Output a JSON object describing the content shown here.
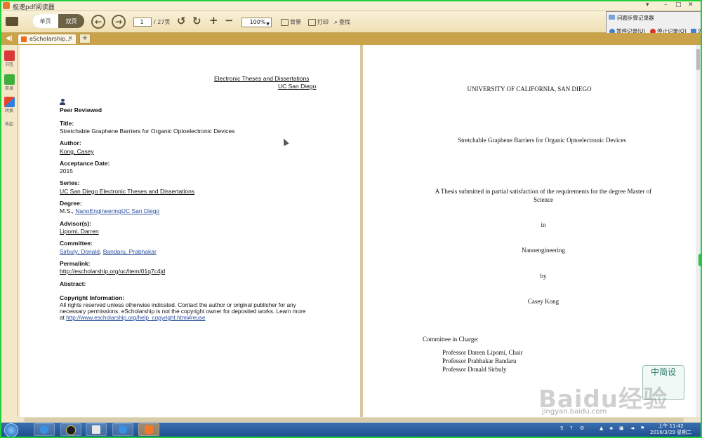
{
  "window": {
    "title": "极速pdf阅读器"
  },
  "toolbar": {
    "single_page": "单页",
    "double_page": "双页",
    "page_current": "1",
    "page_total": "/ 27页",
    "zoom": "100%",
    "background": "背景",
    "print": "打印",
    "find": "查找"
  },
  "popup": {
    "title": "问题步骤记录器",
    "pause": "暂停记录(U)",
    "stop": "停止记录(O)",
    "add": "添"
  },
  "tabs": [
    {
      "label": "eScholarship..."
    }
  ],
  "sidebar": {
    "items": [
      {
        "label": "书签"
      },
      {
        "label": "目录"
      },
      {
        "label": "转换"
      },
      {
        "label": "收起"
      }
    ]
  },
  "left_page": {
    "header_line1": "Electronic Theses and Dissertations",
    "header_line2": "UC San Diego",
    "peer_reviewed": "Peer Reviewed",
    "title_label": "Title:",
    "title_value": "Stretchable Graphene Barriers for Organic Optoelectronic Devices",
    "author_label": "Author:",
    "author_value": "Kong, Casey",
    "acceptance_label": "Acceptance Date:",
    "acceptance_value": "2015",
    "series_label": "Series:",
    "series_value": "UC San Diego Electronic Theses and Dissertations",
    "degree_label": "Degree:",
    "degree_prefix": "M.S., ",
    "degree_value": "NanoEngineeringUC San Diego",
    "advisor_label": "Advisor(s):",
    "advisor_value": "Lipomi, Darren",
    "committee_label": "Committee:",
    "committee_value1": "Sirbuly, Donald",
    "committee_sep": ", ",
    "committee_value2": "Bandaru, Prabhakar",
    "permalink_label": "Permalink:",
    "permalink_value": "http://escholarship.org/uc/item/01q7c4jd",
    "abstract_label": "Abstract:",
    "copyright_label": "Copyright Information:",
    "copyright_line1": "All rights reserved unless otherwise indicated. Contact the author or original publisher for any",
    "copyright_line2": "necessary permissions. eScholarship is not the copyright owner for deposited works. Learn more",
    "copyright_line3_prefix": "at ",
    "copyright_link": "http://www.escholarship.org/help_copyright.html#reuse"
  },
  "right_page": {
    "university": "UNIVERSITY OF CALIFORNIA, SAN DIEGO",
    "thesis_title": "Stretchable Graphene Barriers for Organic Optoelectronic Devices",
    "submitted_line1": "A Thesis submitted in partial satisfaction of the requirements for the degree Master of",
    "submitted_line2": "Science",
    "in": "in",
    "field": "Nanoengineering",
    "by": "by",
    "author": "Casey Kong",
    "committee_heading": "Committee in Charge:",
    "members": [
      "Professor Darren Lipomi, Chair",
      "Professor Prabhakar Bandaru",
      "Professor Donald Sirbuly"
    ]
  },
  "taskbar": {
    "time": "上午 11:42",
    "date": "2016/3/29 星期二"
  },
  "watermark": {
    "text": "Baidu经验",
    "url": "jingyan.baidu.com",
    "badge": "中简设"
  }
}
